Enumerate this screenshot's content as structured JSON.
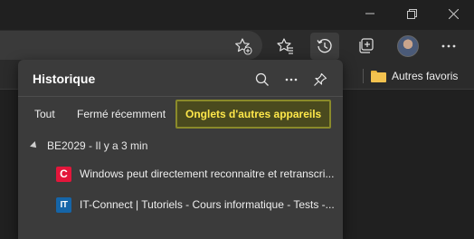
{
  "window": {
    "minimize_icon": "minimize-icon",
    "restore_icon": "restore-icon",
    "close_icon": "close-icon"
  },
  "toolbar": {
    "icons": [
      "add-favorite-icon",
      "favorites-icon",
      "history-icon",
      "collections-icon",
      "profile-avatar",
      "more-icon"
    ]
  },
  "favorites_bar": {
    "folder_label": "Autres favoris"
  },
  "history": {
    "title": "Historique",
    "tabs": [
      {
        "label": "Tout"
      },
      {
        "label": "Fermé récemment"
      },
      {
        "label": "Onglets d'autres appareils"
      }
    ],
    "selected_tab": "Onglets d'autres appareils",
    "device": {
      "name": "BE2029 - Il y a 3 min",
      "items": [
        {
          "favicon": "C",
          "title": "Windows peut directement reconnaitre et retranscri..."
        },
        {
          "favicon": "IT",
          "title": "IT-Connect | Tutoriels - Cours informatique - Tests -..."
        }
      ]
    }
  },
  "colors": {
    "accent_selected_text": "#ffe84a",
    "panel_bg": "#3b3b3b"
  }
}
